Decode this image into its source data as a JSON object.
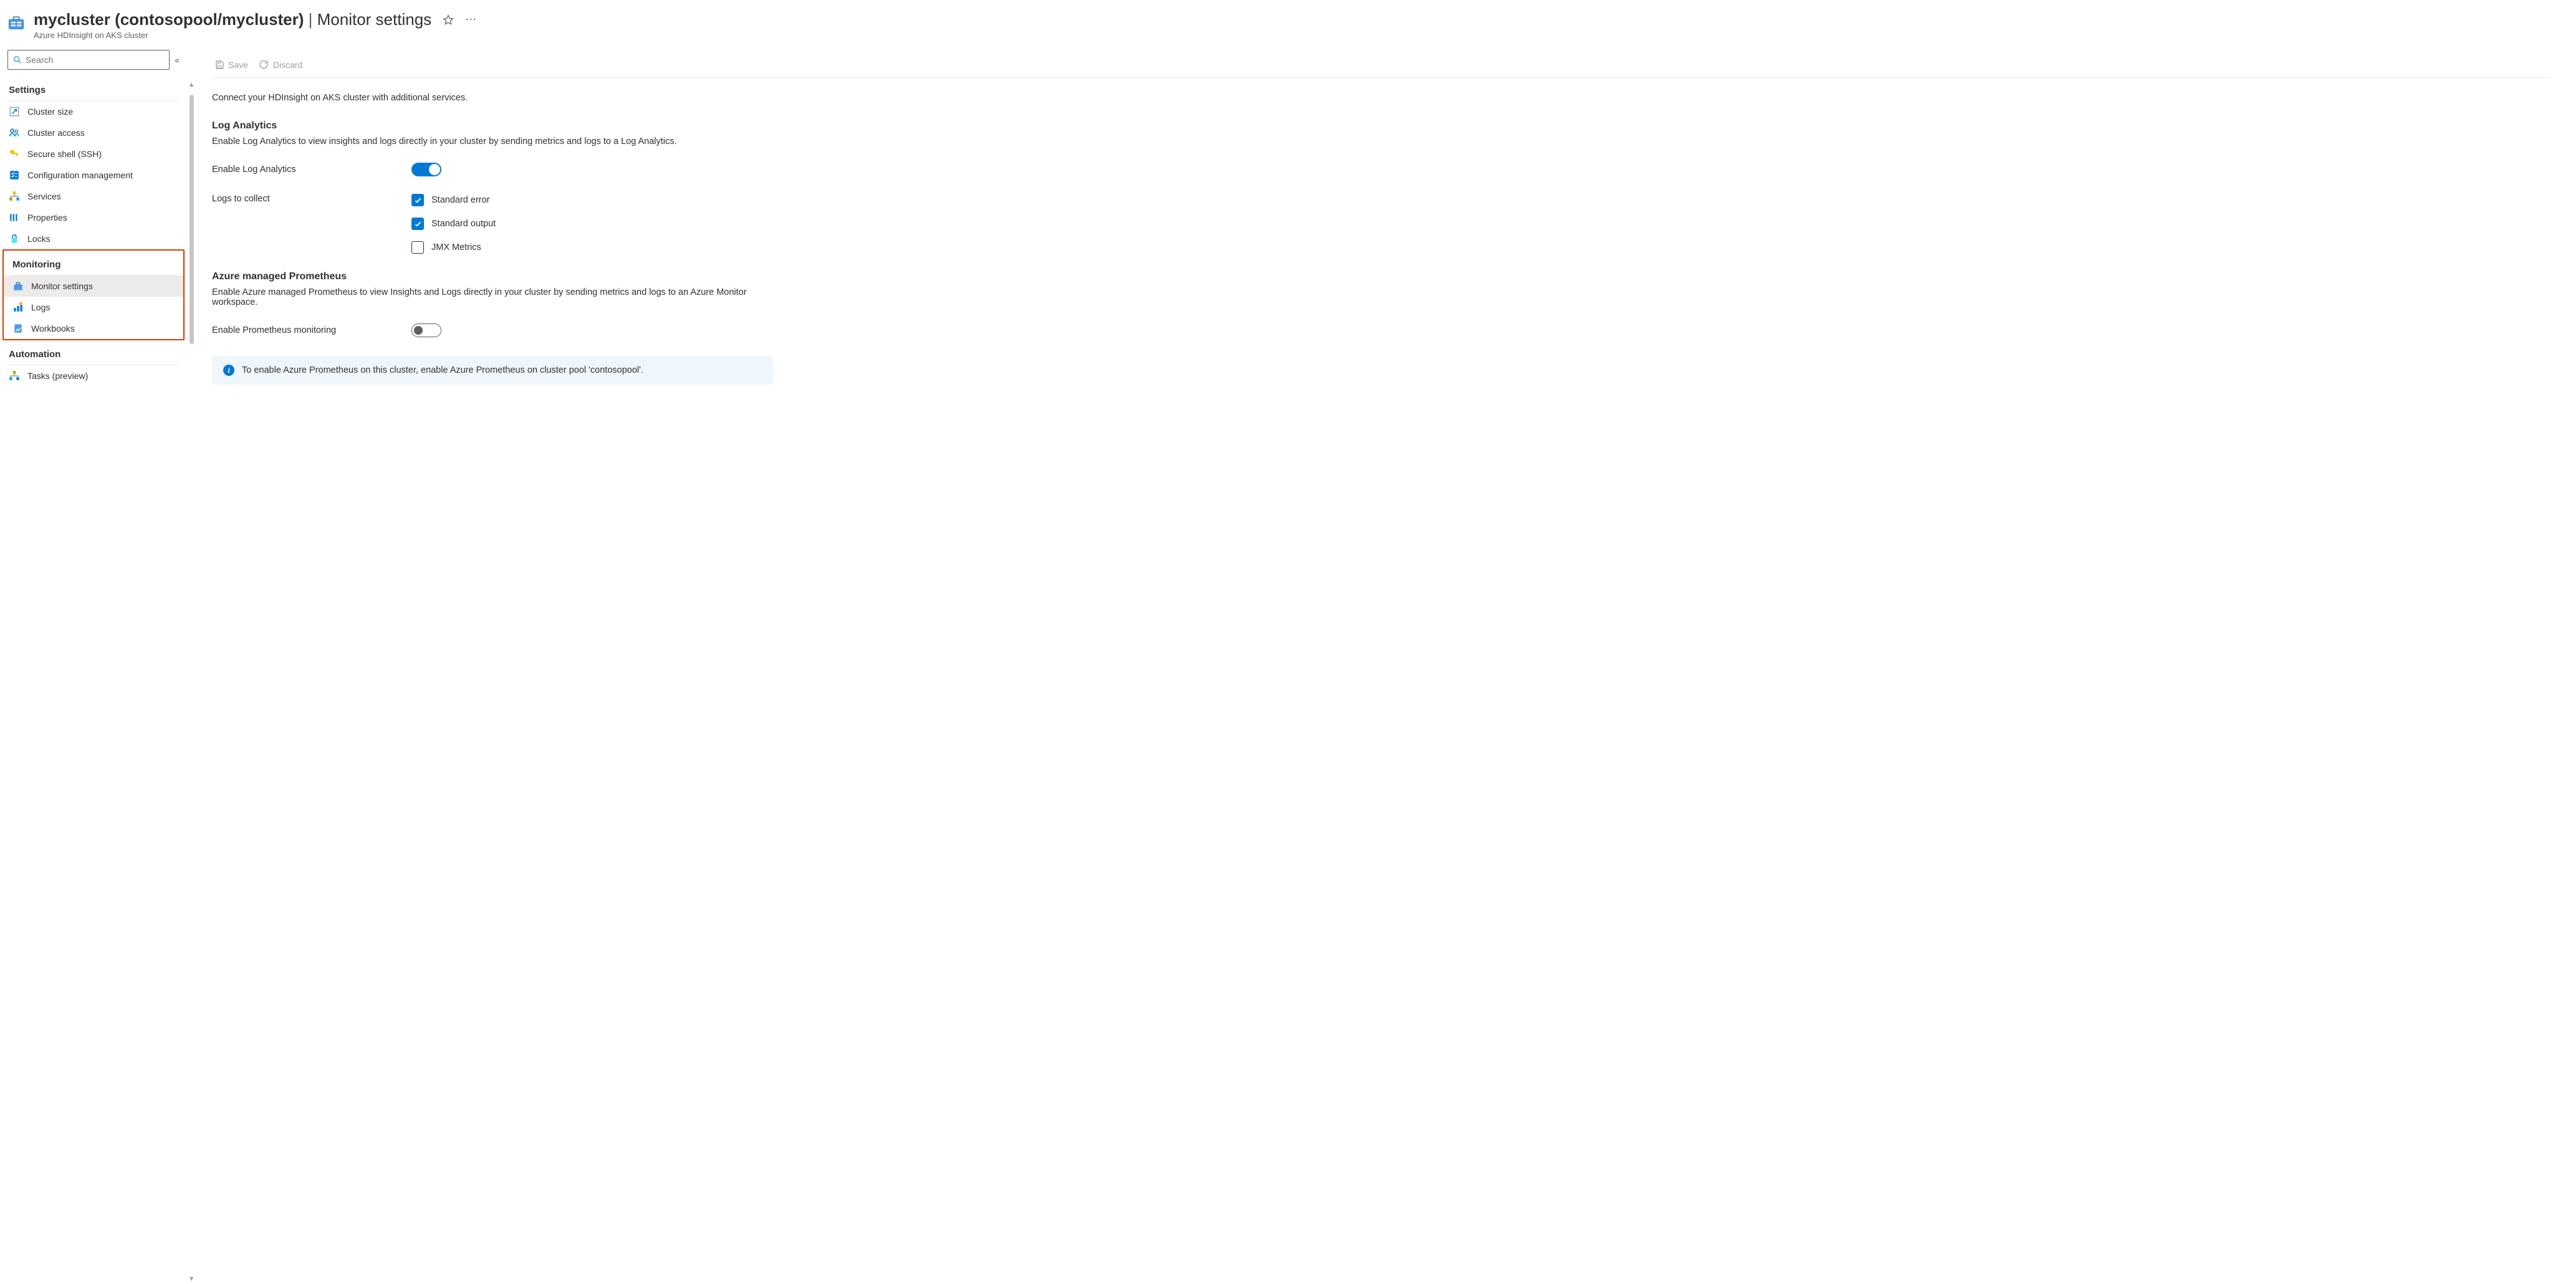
{
  "header": {
    "title_resource": "mycluster (contosopool/mycluster)",
    "title_section": "Monitor settings",
    "subtitle": "Azure HDInsight on AKS cluster"
  },
  "search": {
    "placeholder": "Search"
  },
  "sidebar": {
    "sections": {
      "settings": {
        "label": "Settings",
        "items": {
          "cluster_size": "Cluster size",
          "cluster_access": "Cluster access",
          "secure_shell": "Secure shell (SSH)",
          "config_mgmt": "Configuration management",
          "services": "Services",
          "properties": "Properties",
          "locks": "Locks"
        }
      },
      "monitoring": {
        "label": "Monitoring",
        "items": {
          "monitor_settings": "Monitor settings",
          "logs": "Logs",
          "workbooks": "Workbooks"
        }
      },
      "automation": {
        "label": "Automation",
        "items": {
          "tasks": "Tasks (preview)"
        }
      }
    }
  },
  "toolbar": {
    "save": "Save",
    "discard": "Discard"
  },
  "main": {
    "intro": "Connect your HDInsight on AKS cluster with additional services.",
    "log_analytics": {
      "heading": "Log Analytics",
      "desc": "Enable Log Analytics to view insights and logs directly in your cluster by sending metrics and logs to a Log Analytics.",
      "enable_label": "Enable Log Analytics",
      "logs_label": "Logs to collect",
      "options": {
        "stderr": "Standard error",
        "stdout": "Standard output",
        "jmx": "JMX Metrics"
      }
    },
    "prometheus": {
      "heading": "Azure managed Prometheus",
      "desc": "Enable Azure managed Prometheus to view Insights and Logs directly in your cluster by sending metrics and logs to an Azure Monitor workspace.",
      "enable_label": "Enable Prometheus monitoring",
      "info": "To enable Azure Prometheus on this cluster, enable Azure Prometheus on cluster pool 'contosopool'."
    }
  }
}
